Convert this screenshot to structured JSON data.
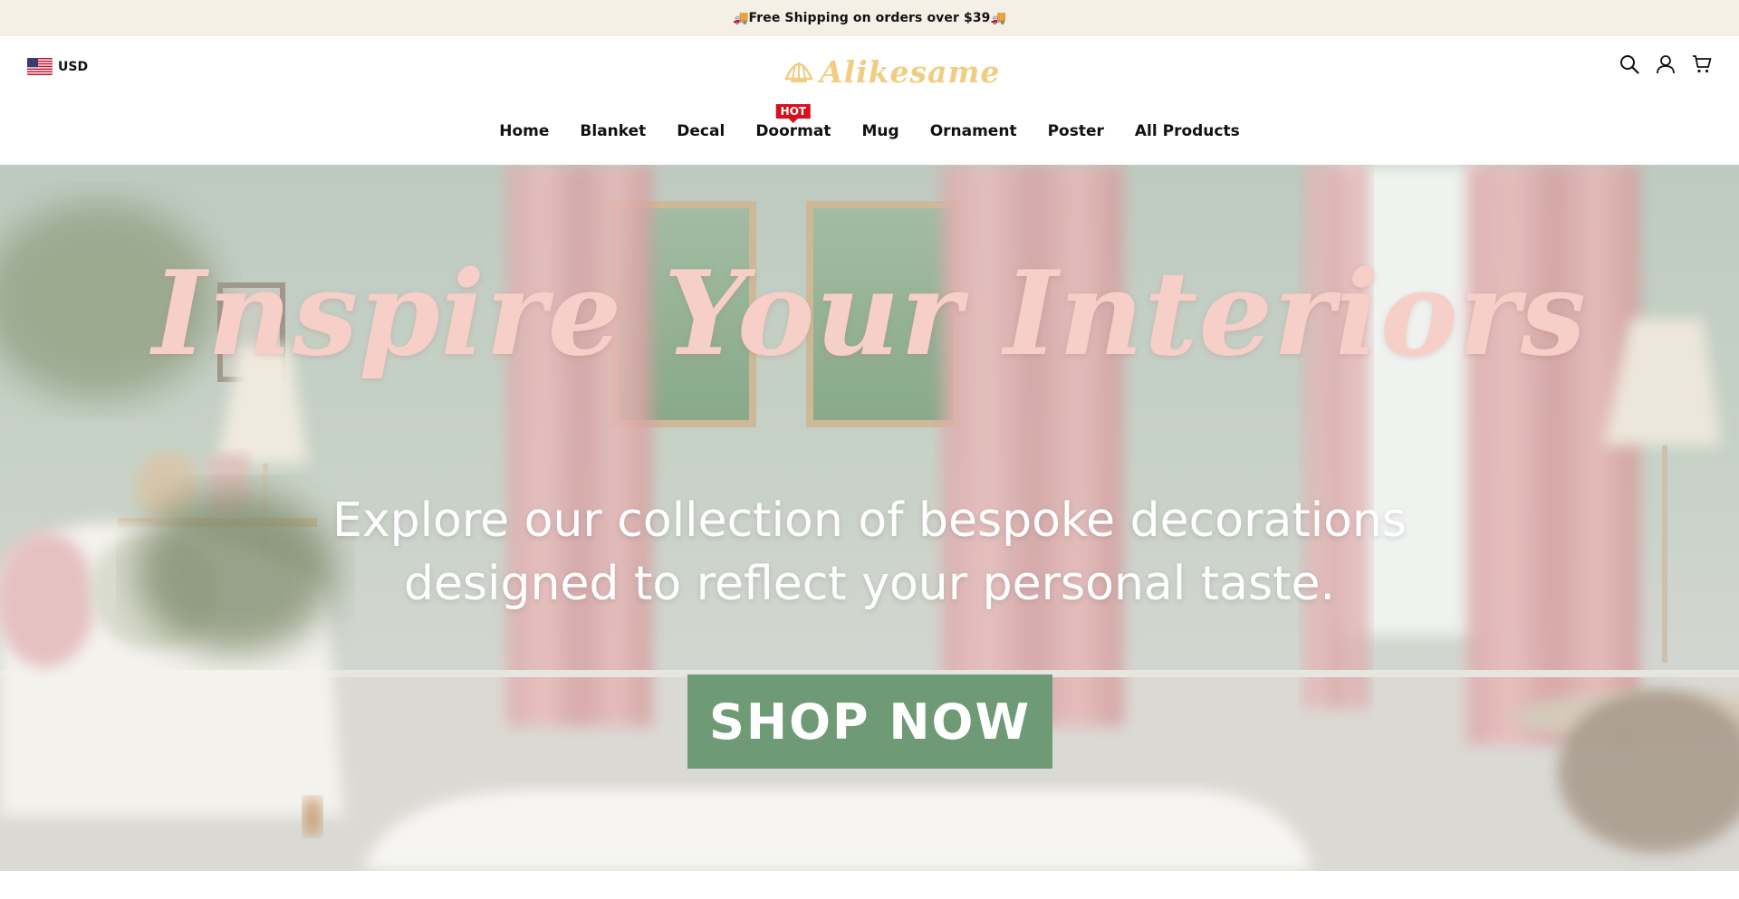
{
  "announcement": {
    "text": "🚚Free Shipping on orders over $39🚚"
  },
  "header": {
    "currency": "USD",
    "logo_text": "Alikesame"
  },
  "nav": {
    "items": [
      {
        "label": "Home"
      },
      {
        "label": "Blanket"
      },
      {
        "label": "Decal"
      },
      {
        "label": "Doormat",
        "badge": "HOT"
      },
      {
        "label": "Mug"
      },
      {
        "label": "Ornament"
      },
      {
        "label": "Poster"
      },
      {
        "label": "All Products"
      }
    ]
  },
  "hero": {
    "title": "Inspire Your Interiors",
    "subtitle_line1": "Explore our collection of bespoke decorations",
    "subtitle_line2": "designed to reflect your personal taste.",
    "cta": "SHOP NOW"
  },
  "colors": {
    "announcement_bg": "#f4f0e6",
    "logo": "#f1cd82",
    "hot_badge": "#d6111c",
    "cta_bg": "#6f9a76",
    "hero_title": "#f6cfc8"
  },
  "icons": [
    "us-flag-icon",
    "logo-shell-icon",
    "search-icon",
    "account-icon",
    "cart-icon"
  ]
}
